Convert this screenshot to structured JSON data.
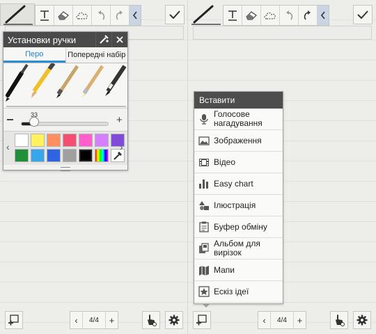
{
  "left": {
    "toolbar": {
      "tools": [
        {
          "icon": "text-tool-icon"
        },
        {
          "icon": "eraser-icon"
        },
        {
          "icon": "cloud-icon"
        },
        {
          "icon": "undo-icon"
        },
        {
          "icon": "redo-icon"
        },
        {
          "icon": "chevron-left-icon"
        }
      ]
    },
    "pen_settings": {
      "title": "Установки ручки",
      "tabs": [
        "Перо",
        "Попередні набір"
      ],
      "active_tab": "Перо",
      "pen_size": "33",
      "pen_size_fraction": 0.33,
      "palette": {
        "row1": [
          "#ffffff",
          "#fff25c",
          "#ff8f5e",
          "#f44e72",
          "#ff5fcd",
          "#d57eff",
          "#7f4bd8"
        ],
        "row2": [
          "#1f8f3a",
          "#38a6ea",
          "#2f63e0",
          "#a0a0a0",
          "#000000",
          "rainbow",
          "eyedropper"
        ]
      }
    },
    "pager": {
      "page": "4/4",
      "prev": "‹",
      "next": "+"
    }
  },
  "right": {
    "insert_menu": {
      "title": "Вставити",
      "items": [
        {
          "icon": "microphone-icon",
          "label": "Голосове нагадування"
        },
        {
          "icon": "image-icon",
          "label": "Зображення"
        },
        {
          "icon": "film-icon",
          "label": "Відео"
        },
        {
          "icon": "bar-chart-icon",
          "label": "Easy chart"
        },
        {
          "icon": "shapes-icon",
          "label": "Ілюстрація"
        },
        {
          "icon": "clipboard-icon",
          "label": "Буфер обміну"
        },
        {
          "icon": "scrapbook-icon",
          "label": "Альбом для вирізок"
        },
        {
          "icon": "map-icon",
          "label": "Мапи"
        },
        {
          "icon": "idea-sketch-icon",
          "label": "Ескіз ідеї"
        }
      ]
    },
    "pager": {
      "page": "4/4",
      "prev": "‹",
      "next": "+"
    }
  }
}
